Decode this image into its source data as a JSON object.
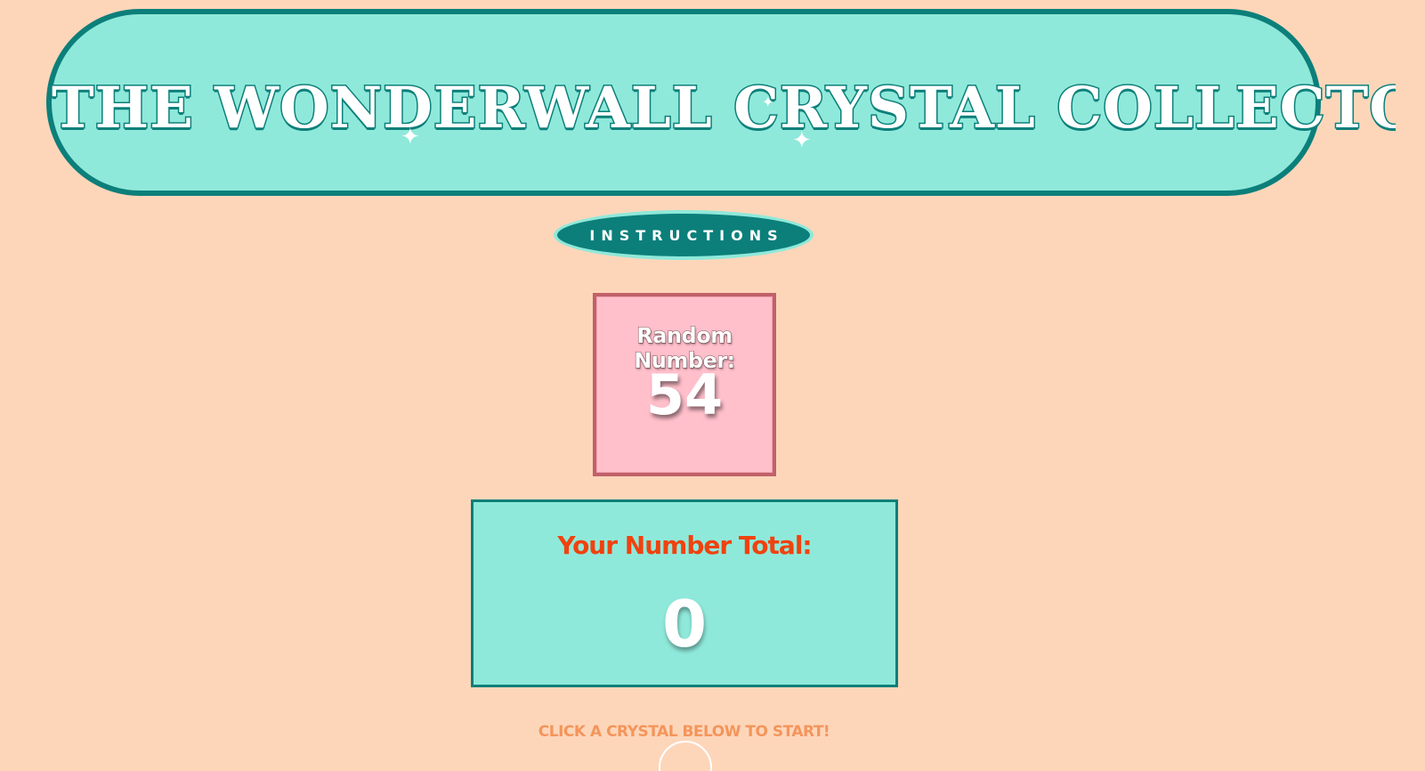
{
  "title": "THE WONDERWALL CRYSTAL COLLECTOR!",
  "instructions_button": "INSTRUCTIONS",
  "random_number": {
    "label": "Random Number:",
    "value": "54"
  },
  "total": {
    "label": "Your Number Total:",
    "value": "0"
  },
  "start_hint": "CLICK A CRYSTAL BELOW TO START!",
  "icons": {
    "sparkle": "sparkle-icon",
    "crystal": "crystal-icon"
  },
  "colors": {
    "background": "#FDD6BA",
    "banner": "#8FE9DA",
    "teal": "#0C7F7A",
    "pink_box": "#FFBFCB",
    "pink_border": "#C0616A",
    "total_label": "#F0420E",
    "hint": "#F4955B"
  }
}
